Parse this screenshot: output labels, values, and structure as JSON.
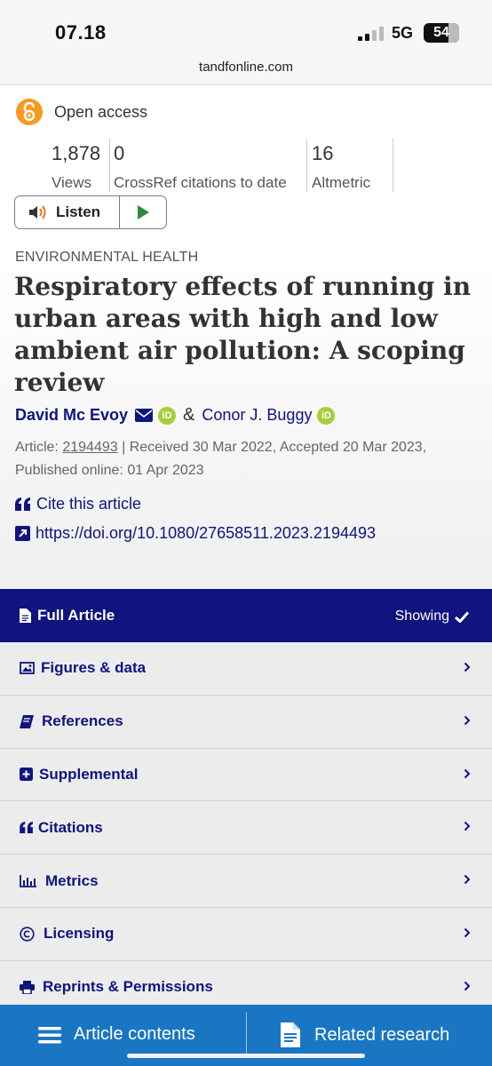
{
  "status": {
    "time": "07.18",
    "network": "5G",
    "battery": "54"
  },
  "browser": {
    "url": "tandfonline.com"
  },
  "access": {
    "label": "Open access"
  },
  "metrics": [
    {
      "value": "1,878",
      "label": "Views"
    },
    {
      "value": "0",
      "label": "CrossRef citations to date"
    },
    {
      "value": "16",
      "label": "Altmetric"
    }
  ],
  "listen": {
    "label": "Listen"
  },
  "article": {
    "category": "ENVIRONMENTAL HEALTH",
    "title": "Respiratory effects of running in urban areas with high and low ambient air pollution: A scoping review",
    "author1": "David Mc Evoy",
    "amp": "&",
    "author2": "Conor J. Buggy",
    "orcid_text": "iD",
    "article_prefix": "Article:",
    "article_number": "2194493",
    "dates": "| Received 30 Mar 2022, Accepted 20 Mar 2023, Published online: 01 Apr 2023",
    "cite_label": "Cite this article",
    "doi": "https://doi.org/10.1080/27658511.2023.2194493"
  },
  "menu": {
    "header": {
      "label": "Full Article",
      "status": "Showing"
    },
    "items": [
      {
        "label": "Figures & data",
        "icon": "image-icon"
      },
      {
        "label": "References",
        "icon": "book-icon"
      },
      {
        "label": "Supplemental",
        "icon": "plus-square-icon"
      },
      {
        "label": "Citations",
        "icon": "quote-icon"
      },
      {
        "label": "Metrics",
        "icon": "bar-chart-icon"
      },
      {
        "label": "Licensing",
        "icon": "copyright-icon"
      },
      {
        "label": "Reprints & Permissions",
        "icon": "printer-icon"
      }
    ]
  },
  "bottom_bar": {
    "contents_label": "Article contents",
    "related_label": "Related research"
  },
  "colors": {
    "brand_navy": "#10147e",
    "bottom_bar_blue": "#1a76c2",
    "open_access_orange": "#f59a1f",
    "orcid_green": "#a6ce39",
    "play_green": "#2e8b3a"
  }
}
